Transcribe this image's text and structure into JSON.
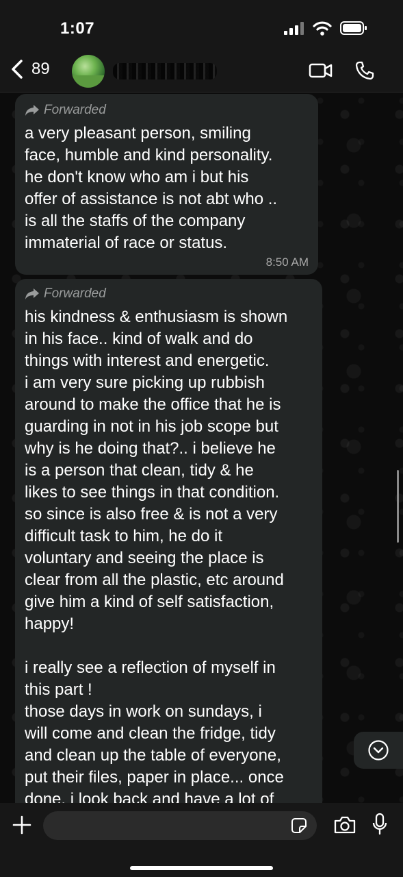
{
  "status_bar": {
    "time": "1:07"
  },
  "header": {
    "back_count": "89"
  },
  "messages": [
    {
      "forwarded_label": "Forwarded",
      "text": "a very pleasant person, smiling\nface, humble and kind personality.\nhe don't know who am i but his\noffer of assistance is not abt who ..\nis all the staffs of the company\nimmaterial of race or status.",
      "time": "8:50 AM"
    },
    {
      "forwarded_label": "Forwarded",
      "text": "his kindness & enthusiasm is shown\nin his face.. kind of walk and do\nthings with interest and energetic.\ni am very sure picking up rubbish\naround to make the office that he is\nguarding in not in his job scope but\nwhy is he doing that?.. i believe he\nis a person that clean, tidy & he\nlikes to see things in that condition.\nso since is also free & is not a very\ndifficult task to him, he do it\nvoluntary and seeing the place is\nclear from all the plastic, etc around\ngive him a kind of self satisfaction,\nhappy!\n\ni really see a reflection of myself in\nthis part !\nthose days in work on sundays, i\nwill come and clean the fridge, tidy\nand clean up the table of everyone,\nput their files, paper in place... once\ndone, i look back and have a lot of"
    }
  ],
  "input": {
    "placeholder": ""
  },
  "colors": {
    "bubble": "#232626",
    "background": "#0c0c0c",
    "bar": "#171717"
  }
}
